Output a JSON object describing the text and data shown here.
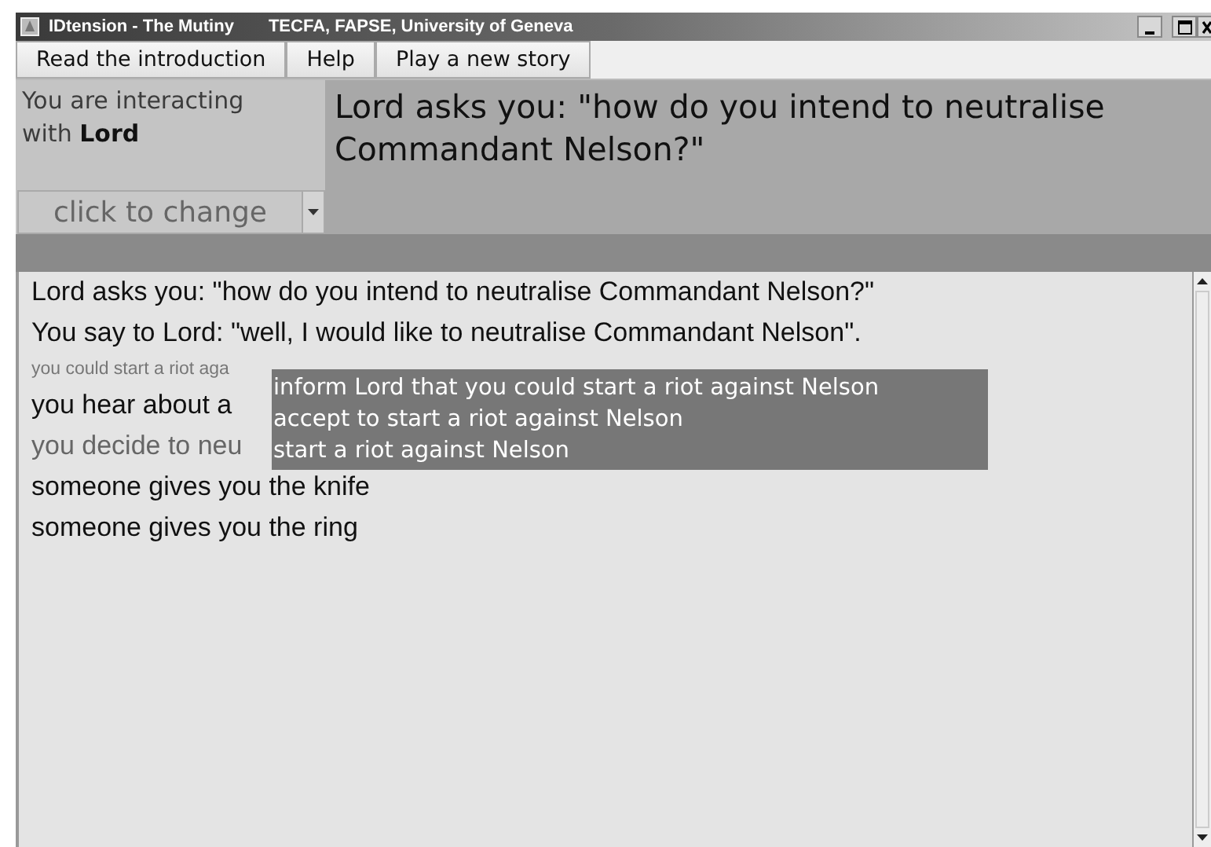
{
  "window": {
    "title": "IDtension - The Mutiny",
    "subtitle": "TECFA, FAPSE, University of Geneva"
  },
  "menu": [
    "Read the introduction",
    "Help",
    "Play a new story"
  ],
  "interlocutor": {
    "text": "You are interacting with **Lord**",
    "selector": "click to change"
  },
  "question": "Lord asks you: \"how do you intend to neutralise Commandant Nelson?\"",
  "log": [
    {
      "kind": "normal",
      "text": "Lord asks you: \"how do you intend to neutralise Commandant Nelson?\""
    },
    {
      "kind": "normal",
      "text": "You say to Lord: \"well, I would like to neutralise Commandant Nelson\"."
    },
    {
      "kind": "hint",
      "text": "you could start a riot aga"
    },
    {
      "kind": "normal",
      "text": "you hear about a"
    },
    {
      "kind": "dim",
      "text": "you decide to neu"
    },
    {
      "kind": "normal",
      "text": "someone gives you the knife"
    },
    {
      "kind": "normal",
      "text": "someone gives you the ring"
    }
  ],
  "popup": [
    "inform Lord that you could start a riot against Nelson",
    "accept to start a riot against Nelson",
    "start a riot against Nelson"
  ]
}
